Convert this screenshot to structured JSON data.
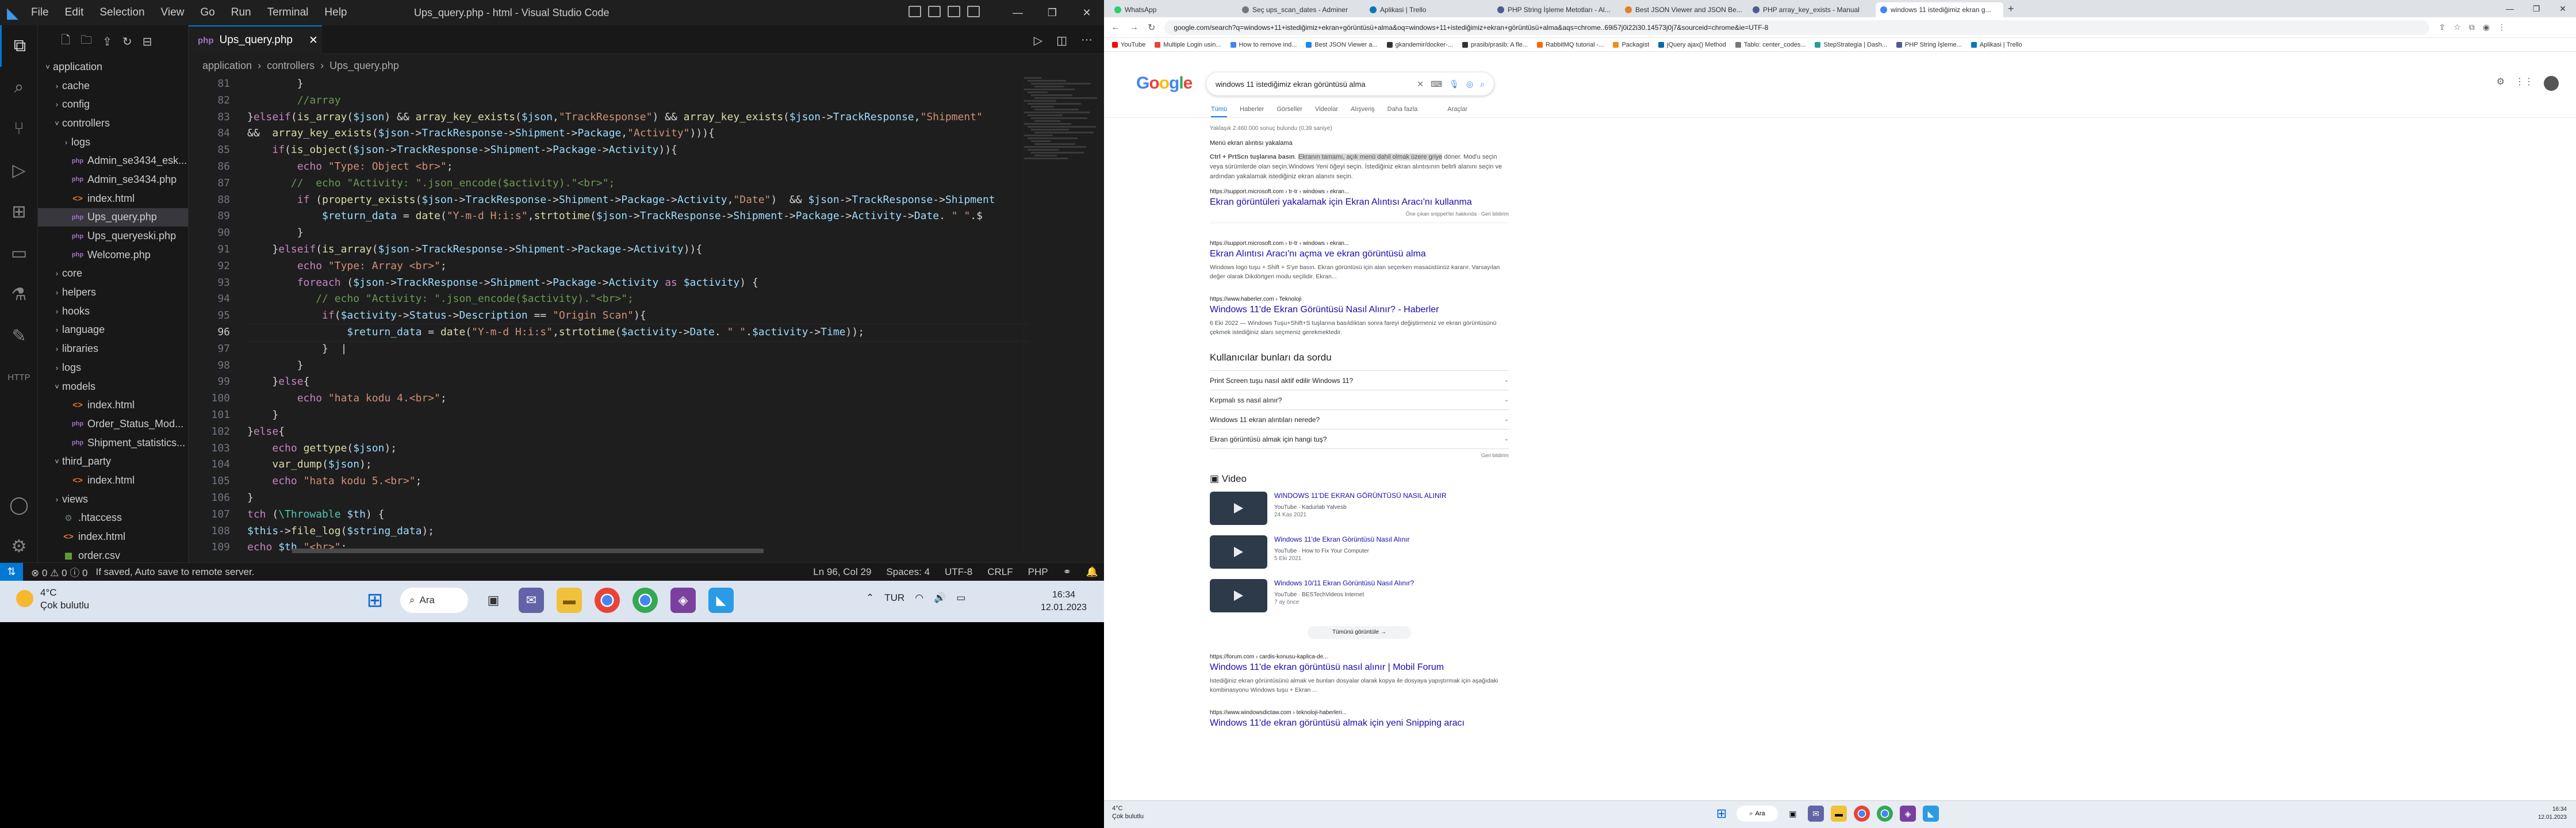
{
  "vscode": {
    "window_title": "Ups_query.php - html - Visual Studio Code",
    "menu": [
      "File",
      "Edit",
      "Selection",
      "View",
      "Go",
      "Run",
      "Terminal",
      "Help"
    ],
    "explorer": [
      {
        "label": "application",
        "indent": 1,
        "chev": "˅",
        "type": "folder"
      },
      {
        "label": "cache",
        "indent": 2,
        "chev": "›",
        "type": "folder"
      },
      {
        "label": "config",
        "indent": 2,
        "chev": "›",
        "type": "folder"
      },
      {
        "label": "controllers",
        "indent": 2,
        "chev": "˅",
        "type": "folder"
      },
      {
        "label": "logs",
        "indent": 3,
        "chev": "›",
        "type": "folder"
      },
      {
        "label": "Admin_se3434_esk...",
        "indent": 3,
        "chev": "",
        "type": "php"
      },
      {
        "label": "Admin_se3434.php",
        "indent": 3,
        "chev": "",
        "type": "php"
      },
      {
        "label": "index.html",
        "indent": 3,
        "chev": "",
        "type": "html"
      },
      {
        "label": "Ups_query.php",
        "indent": 3,
        "chev": "",
        "type": "php",
        "selected": true
      },
      {
        "label": "Ups_queryeski.php",
        "indent": 3,
        "chev": "",
        "type": "php"
      },
      {
        "label": "Welcome.php",
        "indent": 3,
        "chev": "",
        "type": "php"
      },
      {
        "label": "core",
        "indent": 2,
        "chev": "›",
        "type": "folder"
      },
      {
        "label": "helpers",
        "indent": 2,
        "chev": "›",
        "type": "folder"
      },
      {
        "label": "hooks",
        "indent": 2,
        "chev": "›",
        "type": "folder"
      },
      {
        "label": "language",
        "indent": 2,
        "chev": "›",
        "type": "folder"
      },
      {
        "label": "libraries",
        "indent": 2,
        "chev": "›",
        "type": "folder"
      },
      {
        "label": "logs",
        "indent": 2,
        "chev": "›",
        "type": "folder"
      },
      {
        "label": "models",
        "indent": 2,
        "chev": "˅",
        "type": "folder"
      },
      {
        "label": "index.html",
        "indent": 3,
        "chev": "",
        "type": "html"
      },
      {
        "label": "Order_Status_Mod...",
        "indent": 3,
        "chev": "",
        "type": "php"
      },
      {
        "label": "Shipment_statistics...",
        "indent": 3,
        "chev": "",
        "type": "php"
      },
      {
        "label": "third_party",
        "indent": 2,
        "chev": "˅",
        "type": "folder"
      },
      {
        "label": "index.html",
        "indent": 3,
        "chev": "",
        "type": "html"
      },
      {
        "label": "views",
        "indent": 2,
        "chev": "›",
        "type": "folder"
      },
      {
        "label": ".htaccess",
        "indent": 2,
        "chev": "",
        "type": "cfg"
      },
      {
        "label": "index.html",
        "indent": 2,
        "chev": "",
        "type": "html"
      },
      {
        "label": "order.csv",
        "indent": 2,
        "chev": "",
        "type": "csv"
      }
    ],
    "tab": {
      "label": "Ups_query.php",
      "icon": "php"
    },
    "breadcrumb": [
      "application",
      "controllers",
      "Ups_query.php"
    ],
    "current_line": 96,
    "code_lines": [
      {
        "n": 81,
        "html": "        <span class='op'>}</span>"
      },
      {
        "n": 82,
        "html": "        <span class='cm'>//array</span>"
      },
      {
        "n": 83,
        "html": "<span class='op'>}</span><span class='kw'>elseif</span><span class='op'>(</span><span class='fn'>is_array</span><span class='op'>(</span><span class='var'>$json</span><span class='op'>) &amp;&amp; </span><span class='fn'>array_key_exists</span><span class='op'>(</span><span class='var'>$json</span><span class='op'>,</span><span class='str'>\"TrackResponse\"</span><span class='op'>) &amp;&amp; </span><span class='fn'>array_key_exists</span><span class='op'>(</span><span class='var'>$json</span><span class='op'>-&gt;</span><span class='var'>TrackResponse</span><span class='op'>,</span><span class='str'>\"Shipment\"</span>"
      },
      {
        "n": 84,
        "html": "<span class='op'>&amp;&amp;  </span><span class='fn'>array_key_exists</span><span class='op'>(</span><span class='var'>$json</span><span class='op'>-&gt;</span><span class='var'>TrackResponse</span><span class='op'>-&gt;</span><span class='var'>Shipment</span><span class='op'>-&gt;</span><span class='var'>Package</span><span class='op'>,</span><span class='str'>\"Activity\"</span><span class='op'>))){</span>"
      },
      {
        "n": 85,
        "html": "    <span class='kw'>if</span><span class='op'>(</span><span class='fn'>is_object</span><span class='op'>(</span><span class='var'>$json</span><span class='op'>-&gt;</span><span class='var'>TrackResponse</span><span class='op'>-&gt;</span><span class='var'>Shipment</span><span class='op'>-&gt;</span><span class='var'>Package</span><span class='op'>-&gt;</span><span class='var'>Activity</span><span class='op'>)){</span>"
      },
      {
        "n": 86,
        "html": "        <span class='kw'>echo</span> <span class='str'>\"Type: Object &lt;br&gt;\"</span><span class='op'>;</span>"
      },
      {
        "n": 87,
        "html": "       <span class='cm'>//  echo \"Activity: \".json_encode($activity).\"&lt;br&gt;\";</span>"
      },
      {
        "n": 88,
        "html": "        <span class='kw'>if</span> <span class='op'>(</span><span class='fn'>property_exists</span><span class='op'>(</span><span class='var'>$json</span><span class='op'>-&gt;</span><span class='var'>TrackResponse</span><span class='op'>-&gt;</span><span class='var'>Shipment</span><span class='op'>-&gt;</span><span class='var'>Package</span><span class='op'>-&gt;</span><span class='var'>Activity</span><span class='op'>,</span><span class='str'>\"Date\"</span><span class='op'>)  &amp;&amp; </span><span class='var'>$json</span><span class='op'>-&gt;</span><span class='var'>TrackResponse</span><span class='op'>-&gt;</span><span class='var'>Shipment</span>"
      },
      {
        "n": 89,
        "html": "            <span class='var'>$return_data</span> <span class='op'>= </span><span class='fn'>date</span><span class='op'>(</span><span class='str'>\"Y-m-d H:i:s\"</span><span class='op'>,</span><span class='fn'>strtotime</span><span class='op'>(</span><span class='var'>$json</span><span class='op'>-&gt;</span><span class='var'>TrackResponse</span><span class='op'>-&gt;</span><span class='var'>Shipment</span><span class='op'>-&gt;</span><span class='var'>Package</span><span class='op'>-&gt;</span><span class='var'>Activity</span><span class='op'>-&gt;</span><span class='var'>Date</span><span class='op'>.</span> <span class='str'>\" \"</span><span class='op'>.$</span>"
      },
      {
        "n": 90,
        "html": "        <span class='op'>}</span>"
      },
      {
        "n": 91,
        "html": "    <span class='op'>}</span><span class='kw'>elseif</span><span class='op'>(</span><span class='fn'>is_array</span><span class='op'>(</span><span class='var'>$json</span><span class='op'>-&gt;</span><span class='var'>TrackResponse</span><span class='op'>-&gt;</span><span class='var'>Shipment</span><span class='op'>-&gt;</span><span class='var'>Package</span><span class='op'>-&gt;</span><span class='var'>Activity</span><span class='op'>)){</span>"
      },
      {
        "n": 92,
        "html": "        <span class='kw'>echo</span> <span class='str'>\"Type: Array &lt;br&gt;\"</span><span class='op'>;</span>"
      },
      {
        "n": 93,
        "html": "        <span class='kw'>foreach</span> <span class='op'>(</span><span class='var'>$json</span><span class='op'>-&gt;</span><span class='var'>TrackResponse</span><span class='op'>-&gt;</span><span class='var'>Shipment</span><span class='op'>-&gt;</span><span class='var'>Package</span><span class='op'>-&gt;</span><span class='var'>Activity</span> <span class='kw'>as</span> <span class='var'>$activity</span><span class='op'>) {</span>"
      },
      {
        "n": 94,
        "html": "           <span class='cm'>// echo \"Activity: \".json_encode($activity).\"&lt;br&gt;\";</span>"
      },
      {
        "n": 95,
        "html": "            <span class='kw'>if</span><span class='op'>(</span><span class='var'>$activity</span><span class='op'>-&gt;</span><span class='var'>Status</span><span class='op'>-&gt;</span><span class='var'>Description</span> <span class='op'>== </span><span class='str'>\"Origin Scan\"</span><span class='op'>){</span>"
      },
      {
        "n": 96,
        "html": "                <span class='var'>$return_data</span> <span class='op'>= </span><span class='fn'>date</span><span class='op'>(</span><span class='str'>\"Y-m-d H:i:s\"</span><span class='op'>,</span><span class='fn'>strtotime</span><span class='op'>(</span><span class='var'>$activity</span><span class='op'>-&gt;</span><span class='var'>Date</span><span class='op'>.</span> <span class='str'>\" \"</span><span class='op'>.</span><span class='var'>$activity</span><span class='op'>-&gt;</span><span class='var'>Time</span><span class='op'>));</span>"
      },
      {
        "n": 97,
        "html": "            <span class='op'>}</span>  <span class='op'>|</span>"
      },
      {
        "n": 98,
        "html": "        <span class='op'>}</span>"
      },
      {
        "n": 99,
        "html": "    <span class='op'>}</span><span class='kw'>else</span><span class='op'>{</span>"
      },
      {
        "n": 100,
        "html": "        <span class='kw'>echo</span> <span class='str'>\"hata kodu 4.&lt;br&gt;\"</span><span class='op'>;</span>"
      },
      {
        "n": 101,
        "html": "    <span class='op'>}</span>"
      },
      {
        "n": 102,
        "html": "<span class='op'>}</span><span class='kw'>else</span><span class='op'>{</span>"
      },
      {
        "n": 103,
        "html": "    <span class='kw'>echo</span> <span class='fn'>gettype</span><span class='op'>(</span><span class='var'>$json</span><span class='op'>);</span>"
      },
      {
        "n": 104,
        "html": "    <span class='fn'>var_dump</span><span class='op'>(</span><span class='var'>$json</span><span class='op'>);</span>"
      },
      {
        "n": 105,
        "html": "    <span class='kw'>echo</span> <span class='str'>\"hata kodu 5.&lt;br&gt;\"</span><span class='op'>;</span>"
      },
      {
        "n": 106,
        "html": "<span class='op'>}</span>"
      },
      {
        "n": 107,
        "html": "<span class='kw'>tch</span> <span class='op'>(</span><span class='ty'>\\Throwable</span> <span class='var'>$th</span><span class='op'>) {</span>"
      },
      {
        "n": 108,
        "html": "<span class='var'>$this</span><span class='op'>-&gt;</span><span class='fn'>file_log</span><span class='op'>(</span><span class='var'>$string_data</span><span class='op'>);</span>"
      },
      {
        "n": 109,
        "html": "<span class='kw'>echo</span> <span class='var'>$th</span><span class='op'>.</span><span class='str'>\"&lt;br&gt;\"</span><span class='op'>;</span>"
      }
    ],
    "status": {
      "problems_errors": "0",
      "problems_warnings": "0",
      "infos": "0",
      "message": "If saved, Auto save to remote server.",
      "position": "Ln 96, Col 29",
      "spaces": "Spaces: 4",
      "encoding": "UTF-8",
      "eol": "CRLF",
      "language": "PHP"
    }
  },
  "taskbar_left": {
    "temp": "4°C",
    "weather": "Çok bulutlu",
    "search": "Ara",
    "lang": "TUR",
    "time": "16:34",
    "date": "12.01.2023"
  },
  "chrome": {
    "tabs": [
      "WhatsApp",
      "Seç ups_scan_dates - Adminer",
      "Aplikasi | Trello",
      "PHP String İşleme Metotları - Al...",
      "Best JSON Viewer and JSON Be...",
      "PHP array_key_exists - Manual",
      "windows 11 istediğimiz ekran g..."
    ],
    "active_tab": 6,
    "url": "google.com/search?q=windows+11+istediğimiz+ekran+görüntüsü+alma&oq=windows+11+istediğimiz+ekran+görüntüsü+alma&aqs=chrome..69i57j0i22i30.14573j0j7&sourceid=chrome&ie=UTF-8",
    "bookmarks": [
      "YouTube",
      "Multiple Login usin...",
      "How to remove ind...",
      "Best JSON Viewer a...",
      "gkandemir/docker-...",
      "prasib/prasib: A fle...",
      "RabbitMQ tutorial -...",
      "Packagist",
      "jQuery ajax() Method",
      "Tablo: center_codes...",
      "StepStrategia | Dash...",
      "PHP String İşleme...",
      "Aplikasi | Trello"
    ],
    "query": "windows 11 istediğimiz ekran görüntüsü alma",
    "search_tabs": [
      "Tümü",
      "Haberler",
      "Görseller",
      "Videolar",
      "Alışveriş",
      "Daha fazla",
      "Araçlar"
    ],
    "result_count": "Yaklaşık 2.460.000 sonuç bulundu (0,39 saniye)",
    "snippet_heading": "Menü ekran alıntısı yakalama",
    "snippet_bold": "Ctrl + PrtScn tuşlarına basın",
    "snippet_highlight": "Ekranın tamamı, açık menü dahil olmak üzere griye",
    "snippet_rest": "döner. Mod'u seçin veya sürümlerde olan seçin.Windows Yeni öğeyi seçin. İstediğiniz ekran alıntısının belirli alanını seçin ve ardından yakalamak istediğiniz ekran alanını seçin.",
    "r1_cite": "https://support.microsoft.com › tr-tr › windows › ekran...",
    "r1_title": "Ekran görüntüleri yakalamak için Ekran Alıntısı Aracı'nı kullanma",
    "r1_feedback": "Öne çıkan snippet'ler hakkında  ·  Geri bildirim",
    "r2_cite": "https://support.microsoft.com › tr-tr › windows › ekran...",
    "r2_title": "Ekran Alıntısı Aracı'nı açma ve ekran görüntüsü alma",
    "r2_desc": "Windows logo tuşu + Shift + S'ye basın. Ekran görüntüsü için alan seçerken masaüstünüz kararır. Varsayılan değer olarak Dikdörtgen modu seçilidir. Ekran...",
    "r3_cite": "https://www.haberler.com › Teknoloji",
    "r3_title": "Windows 11'de Ekran Görüntüsü Nasıl Alınır? - Haberler",
    "r3_desc": "6 Eki 2022 — Windows Tuşu+Shift+S tuşlarına basıldıktan sonra fareyi değiştirmeniz ve ekran görüntüsünü çekmek istediğiniz alanı seçmeniz gerekmektedir.",
    "paa_heading": "Kullanıcılar bunları da sordu",
    "paa": [
      "Print Screen tuşu nasıl aktif edilir Windows 11?",
      "Kırpmalı ss nasıl alınır?",
      "Windows 11 ekran alıntıları nerede?",
      "Ekran görüntüsü almak için hangi tuş?"
    ],
    "feedback": "Geri bildirim",
    "video_heading": "Video",
    "videos": [
      {
        "title": "WINDOWS 11'DE EKRAN GÖRÜNTÜSÜ NASIL ALINIR",
        "source": "YouTube · Kadurlab Yalvesb",
        "date": "24 Kas 2021"
      },
      {
        "title": "Windows 11'de Ekran Görüntüsü Nasıl Alınır",
        "source": "YouTube · How to Fix Your Computer",
        "date": "5 Eki 2021"
      },
      {
        "title": "Windows 10/11 Ekran Görüntüsü Nasıl Alınır?",
        "source": "YouTube · BESTechVideos Internet",
        "date": "7 ay önce"
      }
    ],
    "all_videos": "Tümünü görüntüle  →",
    "r4_cite": "https://forum.com › cardis-konusu-kaplica-de...",
    "r4_title": "Windows 11'de ekran görüntüsü nasıl alınır | Mobil Forum",
    "r4_desc": "İstediğiniz ekran görüntüsünü almak ve bunları dosyalar olarak kopya ile dosyaya yapıştırmak için aşağıdaki kombinasyonu Windows tuşu + Ekran ...",
    "r5_cite": "https://www.windowsdictaw.com › teknoloji-haberleri...",
    "r5_title": "Windows 11'de ekran görüntüsü almak için yeni Snipping aracı"
  },
  "taskbar_right": {
    "temp": "4°C",
    "weather": "Çok bulutlu",
    "search": "Ara",
    "time": "16:34",
    "date": "12.01.2023"
  },
  "colors": {
    "vscode_accent": "#0078d4",
    "google_link": "#1a0dab",
    "google_blue": "#4285f4"
  }
}
